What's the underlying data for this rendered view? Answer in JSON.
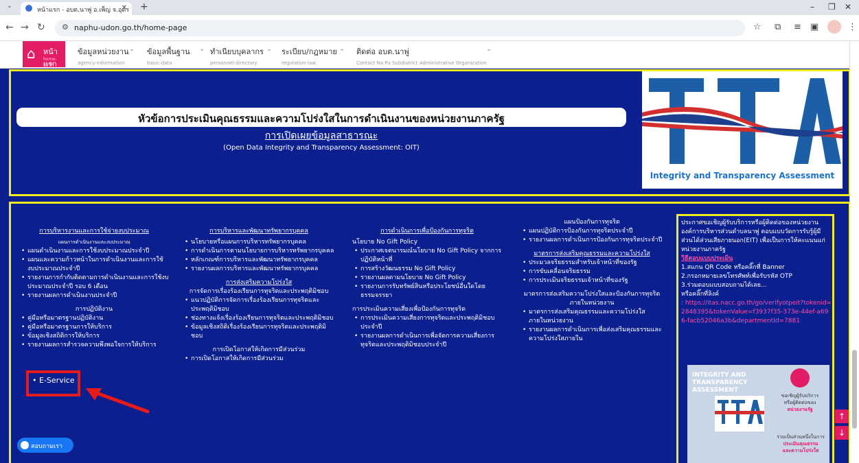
{
  "browser": {
    "tab_title": "หน้าแรก - อบต.นาพู่ อ.เพ็ญ จ.อุดร",
    "url": "naphu-udon.go.th/home-page",
    "new_tab": "+"
  },
  "nav": {
    "home": {
      "label": "หน้าแรก",
      "sub": "home-page"
    },
    "items": [
      {
        "label": "ข้อมูลหน่วยงาน",
        "sub": "agency-information"
      },
      {
        "label": "ข้อมูลพื้นฐาน",
        "sub": "basic-data"
      },
      {
        "label": "ทำเนียบบุคลากร",
        "sub": "personnel-directory"
      },
      {
        "label": "ระเบียบ/กฎหมาย",
        "sub": "regulation-law"
      },
      {
        "label": "ติดต่อ อบต.นาพู่",
        "sub": "Contact Na Pu Subdistrict Administrative Organization"
      }
    ]
  },
  "banner": {
    "title": "หัวข้อการประเมินคุณธรรมและความโปร่งใสในการดำเนินงานของหน่วยงานภาครัฐ",
    "subtitle": "การเปิดเผยข้อมูลสาธารณะ",
    "english": "(Open Data Integrity and Transparency Assessment: OIT)",
    "logo_text": "Integrity and Transparency Assessment"
  },
  "col1": {
    "h1": "การบริหารงานและการใช้จ่ายงบประมาณ",
    "sub1": "แผนการดำเนินงานและงบประมาณ",
    "items1": [
      "แผนดำเนินงานและการใช้งบประมาณประจำปี",
      "แผนและความก้าวหน้าในการดำเนินงานและการใช้งบประมาณประจำปี",
      "รายงานการกำกับติดตามการดำเนินงานและการใช้งบประมาณประจำปี รอบ 6 เดือน",
      "รายงานผลการดำเนินงานประจำปี"
    ],
    "h2": "การปฏิบัติงาน",
    "items2": [
      "คู่มือหรือมาตรฐานปฏิบัติงาน",
      "คู่มือหรือมาตรฐานการให้บริการ",
      "ข้อมูลเชิงสถิติการให้บริการ",
      "รายงานผลการสำรวจความพึงพอใจการให้บริการ",
      "E-Service"
    ]
  },
  "col2": {
    "h1": "การบริหารและพัฒนาทรัพยากรบุคคล",
    "items1": [
      "นโยบายหรือแผนการบริหารทรัพยากรบุคคล",
      "การดำเนินการตามนโยบายการบริหารทรัพยากรบุคคล",
      "หลักเกณฑ์การบริหารและพัฒนาทรัพยากรบุคคล",
      "รายงานผลการบริหารและพัฒนาทรัพยากรบุคคล"
    ],
    "h2": "การส่งเสริมความโปร่งใส",
    "sub2": "การจัดการเรื่องร้องเรียนการทุจริตและประพฤติมิชอบ",
    "items2": [
      "แนวปฏิบัติการจัดการเรื่องร้องเรียนการทุจริตและประพฤติมิชอบ",
      "ช่องทางแจ้งเรื่องร้องเรียนการทุจริตและประพฤติมิชอบ",
      "ข้อมูลเชิงสถิติเรื่องร้องเรียนการทุจริตและประพฤติมิชอบ"
    ],
    "sub3": "การเปิดโอกาสให้เกิดการมีส่วนร่วม",
    "items3": [
      "การเปิดโอกาสให้เกิดการมีส่วนร่วม"
    ]
  },
  "col3": {
    "h1": "การดำเนินการเพื่อป้องกันการทุจริต",
    "sub1": "นโยบาย No Gift Policy",
    "items1": [
      "ประกาศเจตนารมณ์นโยบาย No Gift Policy จากการปฏิบัติหน้าที่",
      "การสร้างวัฒนธรรม No Gift Policy",
      "รายงานผลตามนโยบาย No Gift Policy",
      "รายงานการรับทรัพย์สินหรือประโยชน์อื่นใดโดยธรรมจรรยา"
    ],
    "sub2": "การประเมินความเสี่ยงเพื่อป้องกันการทุจริต",
    "items2": [
      "การประเมินความเสี่ยงการทุจริตและประพฤติมิชอบประจำปี",
      "รายงานผลการดำเนินการเพื่อจัดการความเสี่ยงการทุจริตและประพฤติมิชอบประจำปี"
    ]
  },
  "col4": {
    "sub1": "แผนป้องกันการทุจริต",
    "items1": [
      "แผนปฏิบัติการป้องกันการทุจริตประจำปี",
      "รายงานผลการดำเนินการป้องกันการทุจริตประจำปี"
    ],
    "h2": "มาตรการส่งเสริมคุณธรรมและความโปร่งใส",
    "items2": [
      "ประมวลจริยธรรมสำหรับเจ้าหน้าที่ของรัฐ",
      "การขับเคลื่อนจริยธรรม",
      "การประเมินจริยธรรมเจ้าหน้าที่ของรัฐ"
    ],
    "sub3": "มาตรการส่งเสริมความโปร่งใสและป้องกันการทุจริตภายในหน่วยงาน",
    "items3": [
      "มาตรการส่งเสริมคุณธรรมและความโปร่งใสภายในหน่วยงาน",
      "รายงานผลการดำเนินการเพื่อส่งเสริมคุณธรรมและความโปร่งใสภายใน"
    ]
  },
  "right": {
    "text": "ประกาศขอเชิญผู้รับบริการหรือผู้ติดต่อของหน่วยงานองค์การบริหารส่วนตำบลนาพู่ ตอบแบบวัดการรับรู้ผู้มีส่วนได้ส่วนเสียภายนอก(EIT) เพื่อเป็นการให้คะแนนแก่หน่วยงานภาครัฐ",
    "howto": "วิธีตอบแบบประเมิน",
    "steps": [
      "1.สแกน QR Code หรือคลิ๊กที่ Banner",
      "2.กรอกหมายเลขโทรศัพท์เพื่อรับรหัส OTP",
      "3.ร่วมตอบแบบสอบถามได้เลย..."
    ],
    "or_link": "หรือคลิ๊กที่ลิงค์",
    "link": ": https://itas.nacc.go.th/go/verifyotpeit?tokenid=2848395&tokenValue=f3937f35-373e-44ef-a696-facb52046a3b&departmentId=7881",
    "card_title1": "INTEGRITY AND",
    "card_title2": "TRANSPARENCY",
    "card_title3": "ASSESSMENT",
    "card_invite1": "ขอเชิญผู้รับบริการ",
    "card_invite2": "หรือผู้ติดต่อของ",
    "card_invite3": "หน่วยงานรัฐ",
    "card_bottom1": "ร่วมเป็นส่วนหนึ่งในการ",
    "card_bottom2": "ประเมินคุณธรรม",
    "card_bottom3": "และความโปร่งใส"
  },
  "messenger": "สอบถามเรา",
  "colors": {
    "accent": "#e31c66",
    "bg": "#0c1f8e",
    "frame": "#f2ec1e",
    "callout": "#e81a1a"
  }
}
